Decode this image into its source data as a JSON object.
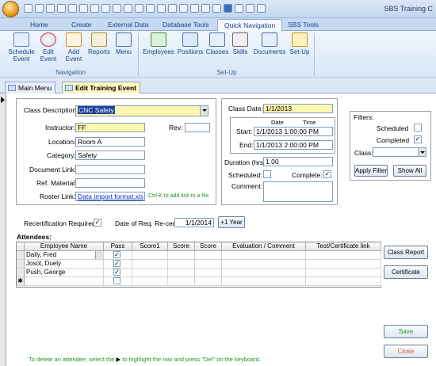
{
  "window": {
    "title": "SBS Training C"
  },
  "ribbon_tabs": [
    "Home",
    "Create",
    "External Data",
    "Database Tools",
    "Quick Navigation",
    "SBS Tools"
  ],
  "ribbon": {
    "navigation": {
      "label": "Navigation",
      "buttons": [
        {
          "line1": "Schedule",
          "line2": "Event"
        },
        {
          "line1": "Edit",
          "line2": "Event"
        },
        {
          "line1": "Add",
          "line2": "Event"
        },
        {
          "line1": "Reports",
          "line2": ""
        },
        {
          "line1": "Menu",
          "line2": ""
        }
      ]
    },
    "setup": {
      "label": "Set-Up",
      "buttons": [
        "Employees",
        "Positions",
        "Classes",
        "Skills",
        "Documents",
        "Set-Up"
      ]
    }
  },
  "doc_tabs": [
    "Main Menu",
    "Edit Training Event"
  ],
  "form": {
    "class_description_label": "Class Description:",
    "class_description_value": "CNC Safety",
    "instructor_label": "Instructor:",
    "instructor_value": "FF",
    "rev_label": "Rev:",
    "rev_value": "",
    "location_label": "Location:",
    "location_value": "Room A",
    "category_label": "Category:",
    "category_value": "Safety",
    "document_link_label": "Document Link:",
    "document_link_value": "",
    "ref_material_label": "Ref. Material:",
    "ref_material_value": "",
    "roster_link_label": "Roster Link:",
    "roster_link_value": "Data import format.xls",
    "roster_hint": "Ctrl-K to add link to a file",
    "class_date_label": "Class Date:",
    "class_date_value": "1/1/2013",
    "date_header": "Date",
    "time_header": "Time",
    "start_label": "Start:",
    "start_value": "1/1/2013 1:00:00 PM",
    "end_label": "End:",
    "end_value": "1/1/2013 2:00:00 PM",
    "duration_label": "Duration (hrs):",
    "duration_value": "1.00",
    "scheduled_label": "Scheduled:",
    "complete_label": "Complete:",
    "comment_label": "Comment:",
    "comment_value": "",
    "recert_label": "Recertification Required:",
    "req_recert_label": "Date of Req. Re-cert.",
    "req_recert_value": "1/1/2014",
    "plus_year_label": "+1 Year"
  },
  "filters": {
    "title": "Filters:",
    "scheduled_label": "Scheduled",
    "completed_label": "Completed",
    "class_label": "Class:",
    "class_value": "",
    "apply_label": "Apply Filter",
    "show_all_label": "Show All"
  },
  "attendees": {
    "title": "Attendees:",
    "columns": [
      "Employee Name",
      "Pass",
      "Score1",
      "Score",
      "Score",
      "Evaluation / Comment",
      "Test/Certificate link"
    ],
    "rows": [
      {
        "name": "Daily, Fred",
        "pass": true
      },
      {
        "name": "Josot, Duely",
        "pass": true
      },
      {
        "name": "Push, George",
        "pass": true
      }
    ]
  },
  "side_buttons": {
    "class_report": "Class Report",
    "certificate": "Certificate",
    "save": "Save",
    "close": "Close"
  },
  "footer_note": {
    "part1": "To delete an attendee, select the",
    "part2": "to highlight the row and press \"Del\" on the keyboard."
  }
}
